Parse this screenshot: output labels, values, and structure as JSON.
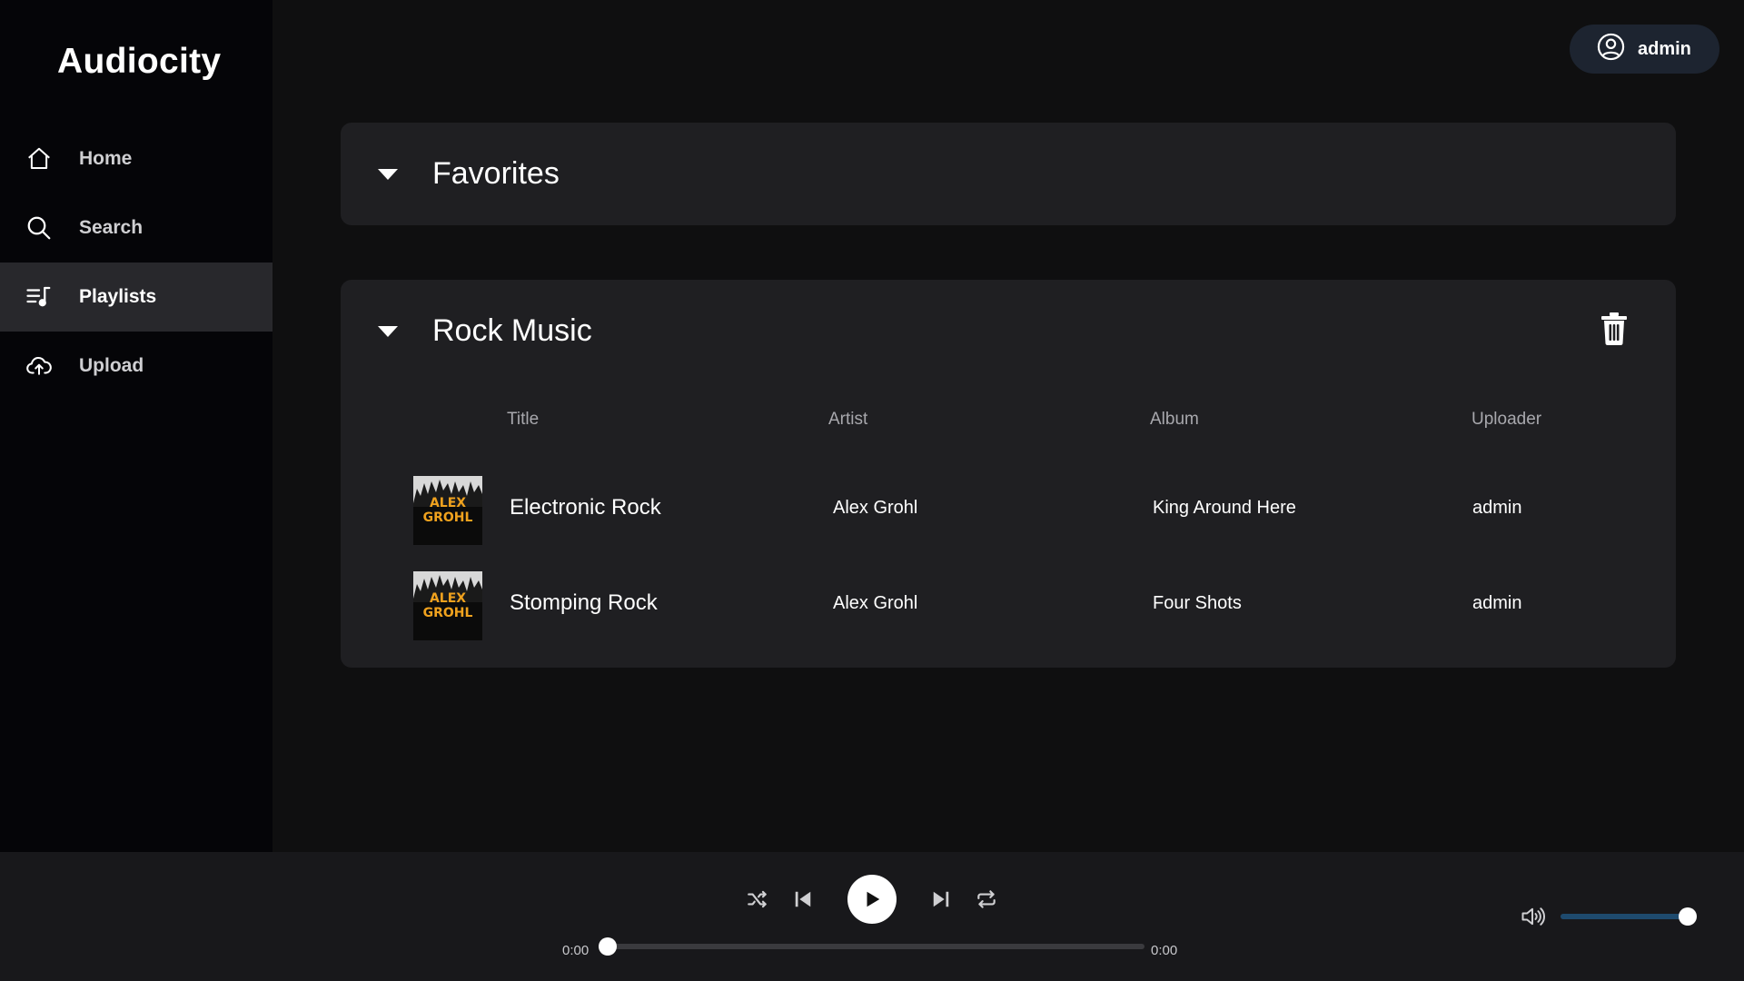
{
  "app": {
    "title": "Audiocity"
  },
  "sidebar": {
    "items": [
      {
        "label": "Home",
        "icon": "home-icon",
        "active": false
      },
      {
        "label": "Search",
        "icon": "search-icon",
        "active": false
      },
      {
        "label": "Playlists",
        "icon": "playlist-icon",
        "active": true
      },
      {
        "label": "Upload",
        "icon": "upload-cloud-icon",
        "active": false
      }
    ]
  },
  "header": {
    "user": {
      "name": "admin",
      "icon": "user-circle-icon"
    }
  },
  "playlists": [
    {
      "name": "Favorites",
      "expanded": true,
      "icon": "caret-down-icon"
    },
    {
      "name": "Rock Music",
      "expanded": true,
      "icon": "caret-down-icon",
      "delete_icon": "trash-icon",
      "columns": [
        "Title",
        "Artist",
        "Album",
        "Uploader"
      ],
      "tracks": [
        {
          "cover_text": [
            "ALEX",
            "GROHL"
          ],
          "title": "Electronic Rock",
          "artist": "Alex Grohl",
          "album": "King Around Here",
          "uploader": "admin"
        },
        {
          "cover_text": [
            "ALEX",
            "GROHL"
          ],
          "title": "Stomping Rock",
          "artist": "Alex Grohl",
          "album": "Four Shots",
          "uploader": "admin"
        }
      ]
    }
  ],
  "player": {
    "controls": [
      "shuffle-icon",
      "previous-icon",
      "play-icon",
      "next-icon",
      "repeat-icon"
    ],
    "elapsed": "0:00",
    "duration": "0:00",
    "progress": 0,
    "volume": 1,
    "volume_icon": "volume-icon",
    "colors": {
      "volume_fill": "#1e4a6e",
      "accent": "#ffffff"
    }
  }
}
